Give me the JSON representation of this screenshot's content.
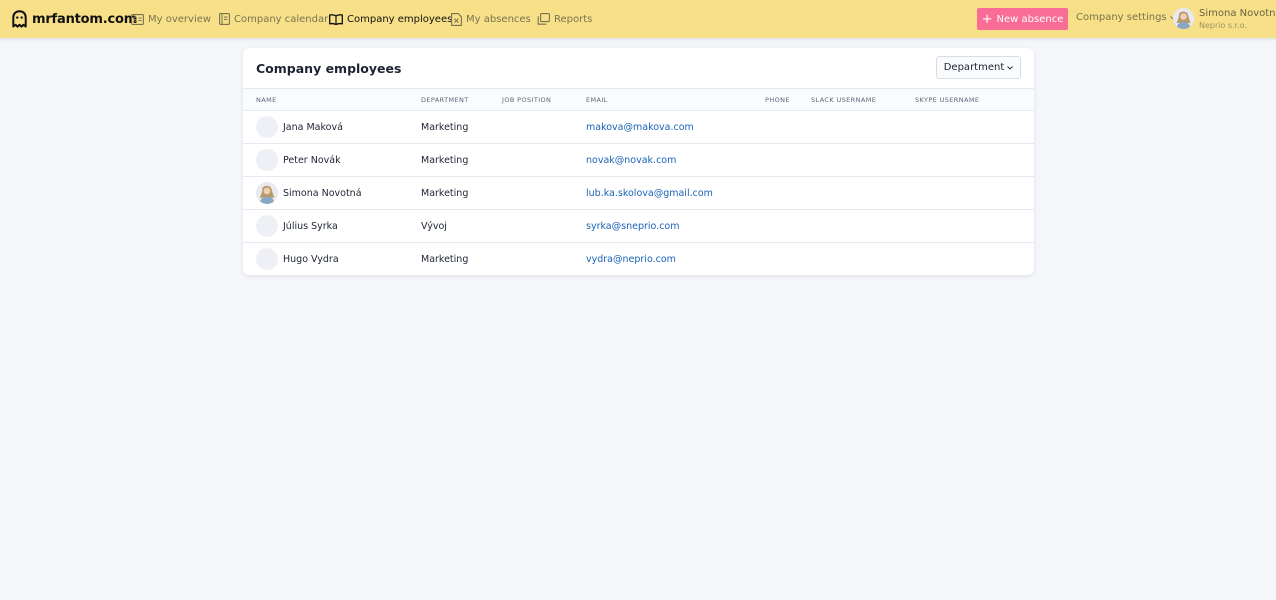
{
  "brand": {
    "name": "mrfantom.com"
  },
  "nav": {
    "items": [
      {
        "label": "My overview",
        "icon": "overview-icon",
        "active": false
      },
      {
        "label": "Company calendar",
        "icon": "calendar-icon",
        "active": false
      },
      {
        "label": "Company employees",
        "icon": "book-icon",
        "active": true
      },
      {
        "label": "My absences",
        "icon": "absence-icon",
        "active": false
      },
      {
        "label": "Reports",
        "icon": "reports-icon",
        "active": false
      }
    ]
  },
  "actions": {
    "new_absence_label": "New absence",
    "company_settings_label": "Company settings"
  },
  "user": {
    "name": "Simona Novotná",
    "company": "Neprio s.r.o."
  },
  "page": {
    "title": "Company employees",
    "filter_label": "Department"
  },
  "table": {
    "columns": [
      "NAME",
      "DEPARTMENT",
      "JOB POSITION",
      "EMAIL",
      "PHONE",
      "SLACK USERNAME",
      "SKYPE USERNAME"
    ],
    "rows": [
      {
        "name": "Jana Maková",
        "department": "Marketing",
        "job_position": "",
        "email": "makova@makova.com",
        "phone": "",
        "slack": "",
        "skype": "",
        "has_photo": false
      },
      {
        "name": "Peter Novák",
        "department": "Marketing",
        "job_position": "",
        "email": "novak@novak.com",
        "phone": "",
        "slack": "",
        "skype": "",
        "has_photo": false
      },
      {
        "name": "Simona Novotná",
        "department": "Marketing",
        "job_position": "",
        "email": "lub.ka.skolova@gmail.com",
        "phone": "",
        "slack": "",
        "skype": "",
        "has_photo": true
      },
      {
        "name": "Július Syrka",
        "department": "Vývoj",
        "job_position": "",
        "email": "syrka@sneprio.com",
        "phone": "",
        "slack": "",
        "skype": "",
        "has_photo": false
      },
      {
        "name": "Hugo Vydra",
        "department": "Marketing",
        "job_position": "",
        "email": "vydra@neprio.com",
        "phone": "",
        "slack": "",
        "skype": "",
        "has_photo": false
      }
    ]
  },
  "colors": {
    "topbar": "#f7e088",
    "accent": "#f86c96",
    "link": "#1b63b8",
    "background": "#f4f6fa"
  }
}
